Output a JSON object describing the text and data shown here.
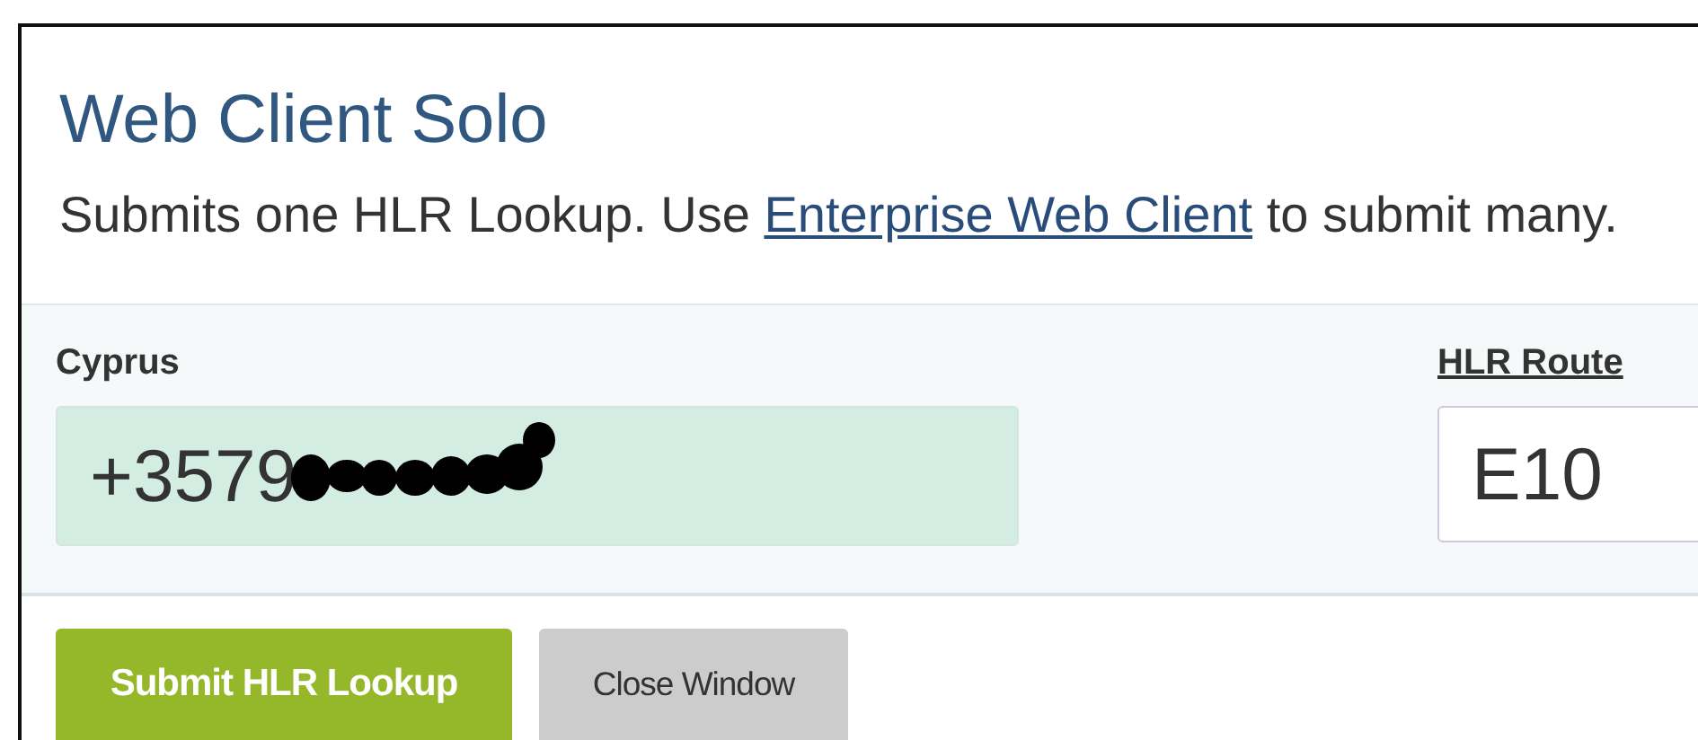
{
  "title": "Web Client Solo",
  "description": {
    "before": "Submits one HLR Lookup. Use ",
    "link": "Enterprise Web Client",
    "after": " to submit many."
  },
  "fields": [
    {
      "kind": "phone",
      "label": "Cyprus",
      "value": "+3579",
      "redacted": true
    },
    {
      "kind": "route",
      "label": "HLR Route",
      "value": "E10"
    }
  ],
  "buttons": [
    {
      "kind": "primary",
      "label": "Submit HLR Lookup"
    },
    {
      "kind": "secondary",
      "label": "Close Window"
    }
  ]
}
